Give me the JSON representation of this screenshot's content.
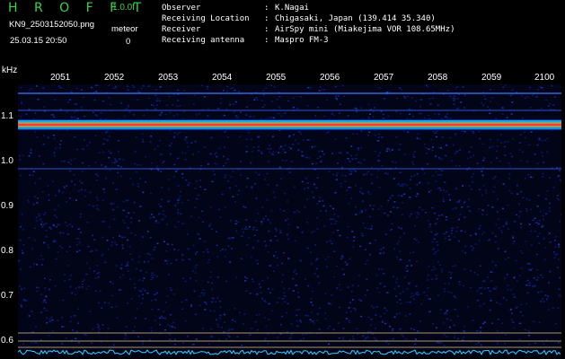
{
  "header": {
    "app_title": "H R O F F T",
    "version": "1.0.0f",
    "file_name": "KN9_2503152050.png",
    "timestamp": "25.03.15 20:50",
    "meteor_label": "meteor",
    "meteor_count": "0"
  },
  "info": {
    "rows": [
      {
        "key": "Observer",
        "sep": ":",
        "value": "K.Nagai"
      },
      {
        "key": "Receiving Location",
        "sep": ":",
        "value": "Chigasaki, Japan (139.414 35.340)"
      },
      {
        "key": "Receiver",
        "sep": ":",
        "value": "AirSpy mini (Miakejima VOR 108.65MHz)"
      },
      {
        "key": "Receiving antenna",
        "sep": ":",
        "value": "Maspro FM-3"
      }
    ]
  },
  "axes": {
    "freq_unit": "kHz",
    "time_labels": [
      "2051",
      "2052",
      "2053",
      "2054",
      "2055",
      "2056",
      "2057",
      "2058",
      "2059",
      "2100"
    ],
    "freq_labels": [
      "1.1",
      "1.0",
      "0.9",
      "0.8",
      "0.7",
      "0.6"
    ]
  },
  "colors": {
    "background": "#000000",
    "title_green": "#3bd14a",
    "noise_blue": "#0a1a6e",
    "signal_cyan": "#1fd0ff",
    "signal_hot": "#ff3b2a",
    "signal_yellow": "#f5e04a"
  }
}
